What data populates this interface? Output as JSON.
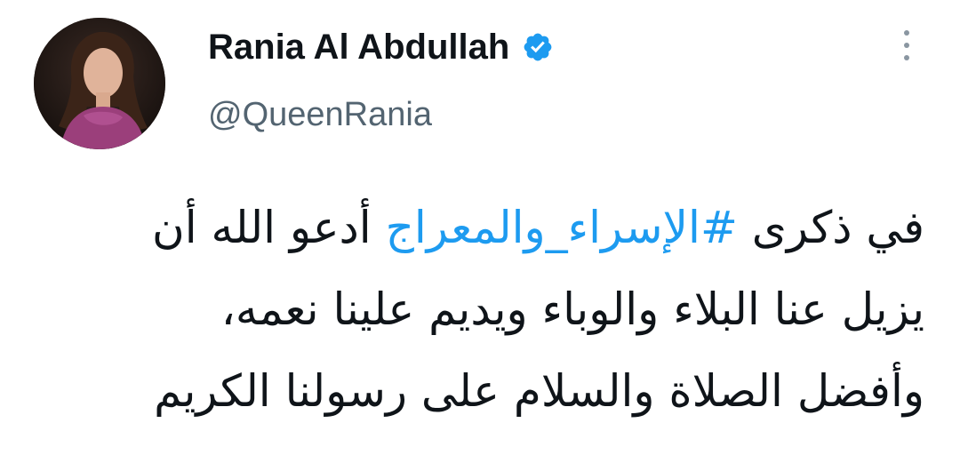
{
  "tweet": {
    "display_name": "Rania Al Abdullah",
    "handle": "@QueenRania",
    "verified": true,
    "avatar_icon": "profile-photo",
    "more_icon": "vertical-ellipsis-icon",
    "lines": [
      {
        "before": "في ذكرى ",
        "hashtag": "#الإسراء_والمعراج",
        "after": " أدعو الله أن"
      },
      {
        "text": "يزيل عنا البلاء والوباء ويديم علينا نعمه،"
      },
      {
        "text": "وأفضل الصلاة والسلام على رسولنا الكريم"
      }
    ]
  },
  "colors": {
    "text": "#0f1419",
    "secondary": "#536471",
    "link": "#1d9bf0",
    "verified": "#1d9bf0"
  }
}
